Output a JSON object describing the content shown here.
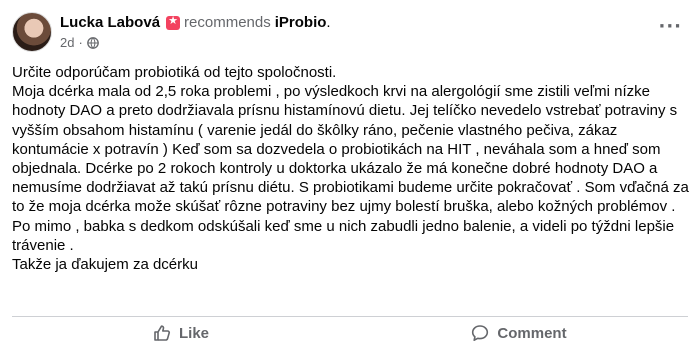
{
  "post": {
    "author": "Lucka Labová",
    "recommends_text": "recommends",
    "page_name": "iProbio",
    "page_suffix": ".",
    "time": "2d",
    "dot": "·",
    "more": "···",
    "paragraphs": [
      "Určite odporúčam probiotiká od tejto spoločnosti.",
      "Moja dcérka mala od 2,5 roka problemi , po výsledkoch krvi na alergológií sme zistili veľmi nízke hodnoty DAO a preto dodržiavala prísnu histamínovú dietu.  Jej telíčko nevedelo vstrebať potraviny s vyšším obsahom histamínu ( varenie jedál do škôlky ráno, pečenie vlastného pečiva, zákaz kontumácie x potravín ) Keď som sa dozvedela o probiotikách na HIT , neváhala som a hneď som objednala. Dcérke po 2 rokoch kontroly u doktorka ukázalo že má konečne dobré hodnoty DAO  a nemusíme dodržiavat až takú prísnu diétu. S probiotikami budeme určite pokračovať . Som vďačná za to že moja dcérka može skúšať rôzne potraviny bez ujmy bolestí bruška, alebo kožných problémov .",
      "Po mimo , babka s dedkom odskúšali keď sme u nich zabudli jedno balenie, a videli po týždni lepšie trávenie .",
      "Takže ja ďakujem za dcérku"
    ]
  },
  "actions": {
    "like_label": "Like",
    "comment_label": "Comment"
  },
  "colors": {
    "recommend_icon": "#f3425f",
    "secondary_text": "#65676b",
    "divider": "#ced0d4"
  },
  "icons": [
    "recommend-star-icon",
    "globe-icon",
    "more-options-icon",
    "like-thumb-icon",
    "comment-bubble-icon"
  ]
}
